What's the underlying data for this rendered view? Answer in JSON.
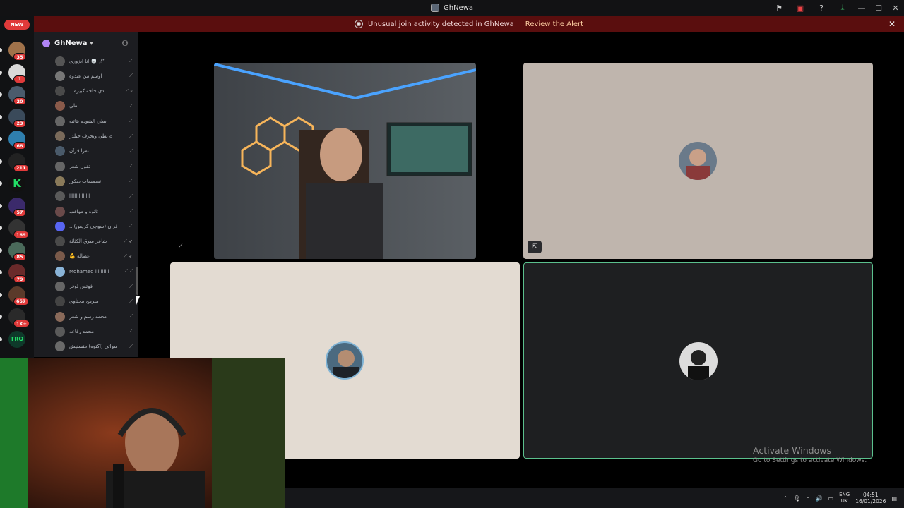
{
  "window": {
    "title": "GhNewa",
    "controls": [
      "—",
      "☐",
      "✕"
    ]
  },
  "toolbar": {
    "icons": [
      "inbox-flag-icon",
      "screen-share-icon",
      "help-icon",
      "download-icon"
    ]
  },
  "alert": {
    "message": "Unusual join activity detected in GhNewa",
    "action": "Review the Alert",
    "close": "✕"
  },
  "rail": {
    "new_label": "NEW",
    "servers": [
      {
        "badge": "35",
        "color": "#a0724a"
      },
      {
        "badge": "1",
        "color": "#d9d9d9"
      },
      {
        "badge": "20",
        "color": "#4a5b6c"
      },
      {
        "badge": "23",
        "color": "#3a4a5a"
      },
      {
        "badge": "68",
        "color": "#2f7fae"
      },
      {
        "badge": "211",
        "color": "#222"
      },
      {
        "badge": "",
        "color": "#111",
        "letter": "K"
      },
      {
        "badge": "57",
        "color": "#3b2a6b"
      },
      {
        "badge": "169",
        "color": "#333"
      },
      {
        "badge": "85",
        "color": "#4a6a5a"
      },
      {
        "badge": "79",
        "color": "#6a2a2a"
      },
      {
        "badge": "657",
        "color": "#5a3a2a"
      },
      {
        "badge": "1K+",
        "color": "#2a2a2a"
      },
      {
        "badge": "",
        "color": "#0e3a2a",
        "letter": "TRQ"
      }
    ]
  },
  "sidebar": {
    "server_name": "GhNewa",
    "members": [
      {
        "name": "انا ابزوري 💀 🖊",
        "icons": "⟋"
      },
      {
        "name": "اوسم من عندوه",
        "icons": "⟋"
      },
      {
        "name": "...ادي حاجه كبيره",
        "icons": "⟋ ⌕"
      },
      {
        "name": "بطي",
        "icons": "⟋"
      },
      {
        "name": "بطي الشوده بتاتيه",
        "icons": "⟋"
      },
      {
        "name": "بطي ونجرف جيلدر a",
        "icons": "⟋"
      },
      {
        "name": "تقرا قرآن",
        "icons": "⟋"
      },
      {
        "name": "تقول شعر",
        "icons": "⟋"
      },
      {
        "name": "تصميمات ديكور",
        "icons": "⟋"
      },
      {
        "name": "ا‎‎ااااااااااا‎ا‎ا‎ا",
        "icons": "⟋"
      },
      {
        "name": "تاتوه و مواقف",
        "icons": "⟋"
      },
      {
        "name": "...(سوجي كريس) فرآن",
        "icons": "⟋"
      },
      {
        "name": "شاعر سوق الكثاثة",
        "icons": "⟋ ➶"
      },
      {
        "name": "💪 عصاله",
        "icons": "⟋ ➶"
      },
      {
        "name": "Mohamed اااااااااا",
        "icons": "⟋ ⟋"
      },
      {
        "name": "فوتس لوفر",
        "icons": "⟋"
      },
      {
        "name": "مبرمج محتاوي",
        "icons": "⟋"
      },
      {
        "name": "محمد رسم و شعر",
        "icons": "⟋"
      },
      {
        "name": "محمد رفاعه",
        "icons": "⟋"
      },
      {
        "name": "سواتي (اكتوه) متسنيش",
        "icons": "⟋"
      }
    ]
  },
  "stage": {
    "tiles": [
      "video",
      "avatar",
      "avatar",
      "avatar-speaking"
    ]
  },
  "watermark": {
    "line1": "Activate Windows",
    "line2": "Go to Settings to activate Windows."
  },
  "taskbar": {
    "lang1": "ENG",
    "lang2": "UK",
    "time": "04:51",
    "date": "16/01/2026"
  }
}
